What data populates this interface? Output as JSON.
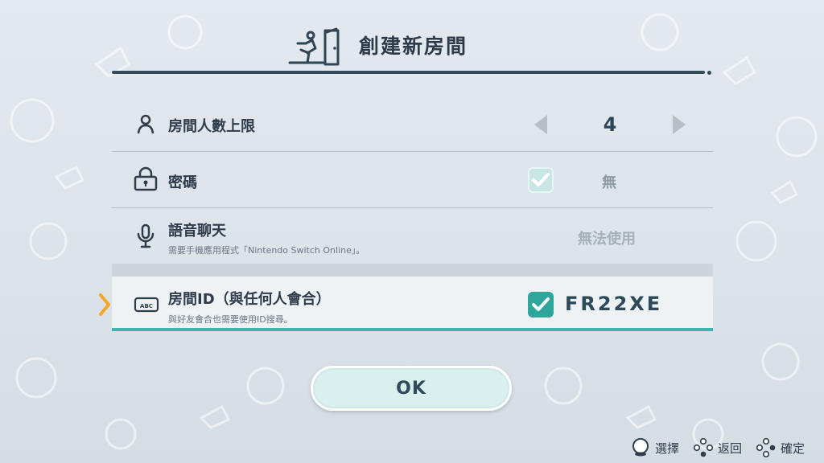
{
  "header": {
    "title": "創建新房間",
    "icon": "exit-door-icon"
  },
  "rows": {
    "max_players": {
      "label": "房間人數上限",
      "value": "4",
      "icon": "person-icon"
    },
    "password": {
      "label": "密碼",
      "value": "無",
      "checked": true,
      "icon": "lock-icon"
    },
    "voice_chat": {
      "label": "語音聊天",
      "sub": "需要手機應用程式「Nintendo Switch Online」。",
      "value": "無法使用",
      "icon": "microphone-icon"
    },
    "room_id": {
      "label": "房間ID（與任何人會合）",
      "sub": "與好友會合也需要使用ID搜尋。",
      "value": "FR22XE",
      "checked": true,
      "icon": "abc-keyboard-icon"
    }
  },
  "ok_button": {
    "label": "OK"
  },
  "footer": {
    "select": {
      "label": "選擇",
      "icon": "stick-icon"
    },
    "back": {
      "label": "返回",
      "icon": "b-button-icon"
    },
    "confirm": {
      "label": "確定",
      "icon": "a-button-icon"
    }
  },
  "colors": {
    "accent": "#3bb6ad",
    "rule": "#344a5b",
    "text": "#2e3b4b"
  }
}
